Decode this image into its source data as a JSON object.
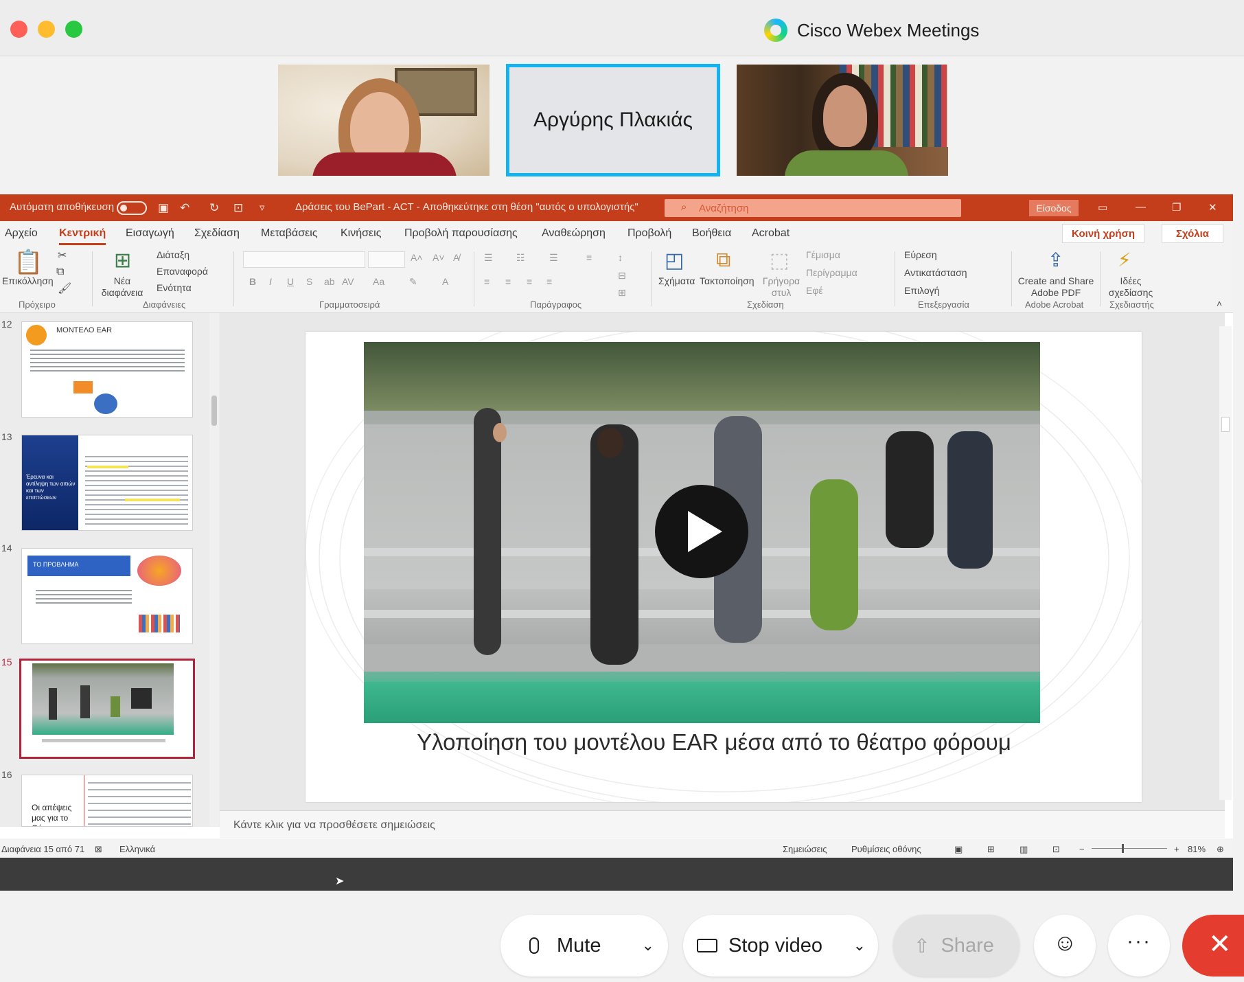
{
  "window": {
    "title": "Cisco Webex Meetings"
  },
  "participants": [
    {
      "name": ""
    },
    {
      "name": "Αργύρης Πλακιάς"
    },
    {
      "name": ""
    }
  ],
  "ppt": {
    "autosave": "Αυτόματη αποθήκευση",
    "doc_title": "Δράσεις του BePart - ACT - Αποθηκεύτηκε στη θέση \"αυτός ο υπολογιστής\"",
    "search_placeholder": "Αναζήτηση",
    "signin": "Είσοδος",
    "menu": [
      "Αρχείο",
      "Κεντρική",
      "Εισαγωγή",
      "Σχεδίαση",
      "Μεταβάσεις",
      "Κινήσεις",
      "Προβολή παρουσίασης",
      "Αναθεώρηση",
      "Προβολή",
      "Βοήθεια",
      "Acrobat"
    ],
    "share_btn": "Κοινή χρήση",
    "comments_btn": "Σχόλια",
    "ribbon": {
      "paste": "Επικόλληση",
      "new_slide": "Νέα διαφάνεια",
      "layout": "Διάταξη",
      "reset": "Επαναφορά",
      "section": "Ενότητα",
      "shapes": "Σχήματα",
      "arrange": "Τακτοποίηση",
      "quick_styles": "Γρήγορα στυλ",
      "fill": "Γέμισμα",
      "outline": "Περίγραμμα",
      "effects": "Εφέ",
      "find": "Εύρεση",
      "replace": "Αντικατάσταση",
      "select": "Επιλογή",
      "adobe": "Create and Share Adobe PDF",
      "design_ideas": "Ιδέες σχεδίασης",
      "groups": [
        "Πρόχειρο",
        "Διαφάνειες",
        "Γραμματοσειρά",
        "Παράγραφος",
        "Σχεδίαση",
        "Επεξεργασία",
        "Adobe Acrobat",
        "Σχεδιαστής"
      ]
    },
    "thumbs": [
      {
        "num": "12",
        "title": "ΜΟΝΤΕΛΟ EAR"
      },
      {
        "num": "13",
        "title": "Έρευνα και αντίληψη των αιτιών και των επιπτώσεων"
      },
      {
        "num": "14",
        "title": "ΤΟ ΠΡΟΒΛΗΜΑ"
      },
      {
        "num": "15",
        "title": ""
      },
      {
        "num": "16",
        "title": "Οι απέψεις μας για το Θέατρο"
      }
    ],
    "slide_caption": "Υλοποίηση του μοντέλου EAR μέσα από το θέατρο φόρουμ",
    "notes_placeholder": "Κάντε κλικ για να προσθέσετε σημειώσεις",
    "status": {
      "slide_count": "Διαφάνεια 15 από 71",
      "language": "Ελληνικά",
      "notes": "Σημειώσεις",
      "display": "Ρυθμίσεις οθόνης",
      "zoom": "81%"
    }
  },
  "controls": {
    "mute": "Mute",
    "stop_video": "Stop video",
    "share": "Share"
  },
  "colors": {
    "ppt_red": "#c43e1c",
    "active_border": "#14b2ee",
    "leave_red": "#e43d30"
  }
}
